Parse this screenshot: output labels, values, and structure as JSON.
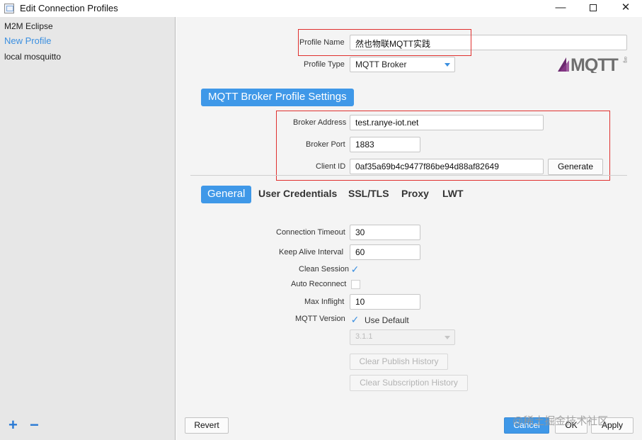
{
  "window": {
    "title": "Edit Connection Profiles",
    "minimize_symbol": "—",
    "close_symbol": "✕"
  },
  "sidebar": {
    "profiles": [
      {
        "label": "M2M Eclipse"
      },
      {
        "label": "New Profile"
      },
      {
        "label": "local mosquitto"
      }
    ],
    "add_symbol": "+",
    "remove_symbol": "−"
  },
  "profile": {
    "name_label": "Profile Name",
    "name_value": "然也物联MQTT实践",
    "type_label": "Profile Type",
    "type_value": "MQTT Broker"
  },
  "logo": {
    "text": "MQTT",
    "small_text": "org"
  },
  "broker": {
    "section_title": "MQTT Broker Profile Settings",
    "address_label": "Broker Address",
    "address_value": "test.ranye-iot.net",
    "port_label": "Broker Port",
    "port_value": "1883",
    "client_id_label": "Client ID",
    "client_id_value": "0af35a69b4c9477f86be94d88af82649",
    "generate_label": "Generate"
  },
  "tabs": [
    {
      "label": "General"
    },
    {
      "label": "User Credentials"
    },
    {
      "label": "SSL/TLS"
    },
    {
      "label": "Proxy"
    },
    {
      "label": "LWT"
    }
  ],
  "general": {
    "connection_timeout_label": "Connection Timeout",
    "connection_timeout_value": "30",
    "keep_alive_label": "Keep Alive Interval",
    "keep_alive_value": "60",
    "clean_session_label": "Clean Session",
    "clean_session_checked": true,
    "auto_reconnect_label": "Auto Reconnect",
    "auto_reconnect_checked": false,
    "max_inflight_label": "Max Inflight",
    "max_inflight_value": "10",
    "mqtt_version_label": "MQTT Version",
    "use_default_label": "Use Default",
    "use_default_checked": true,
    "version_value": "3.1.1",
    "clear_publish_label": "Clear Publish History",
    "clear_subscription_label": "Clear Subscription History"
  },
  "footer": {
    "revert_label": "Revert",
    "cancel_label": "Cancel",
    "ok_label": "OK",
    "apply_label": "Apply"
  },
  "watermark": "@稀土掘金技术社区",
  "colors": {
    "accent": "#3f98e8",
    "highlight_box": "#e0302e",
    "sidebar_bg": "#e7e7e7",
    "main_bg": "#f4f4f4"
  }
}
